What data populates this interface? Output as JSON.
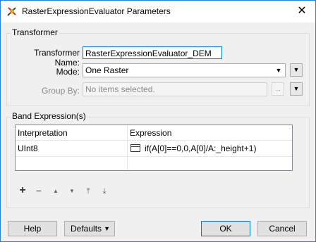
{
  "window": {
    "title": "RasterExpressionEvaluator Parameters",
    "close_glyph": "✕"
  },
  "transformer": {
    "group_label": "Transformer",
    "name_label": "Transformer Name:",
    "name_value": "RasterExpressionEvaluator_DEM",
    "mode_label": "Mode:",
    "mode_value": "One Raster",
    "group_by_label": "Group By:",
    "group_by_placeholder": "No items selected.",
    "browse_label": "..."
  },
  "band_expressions": {
    "group_label": "Band Expression(s)",
    "columns": [
      "Interpretation",
      "Expression"
    ],
    "rows": [
      {
        "interpretation": "UInt8",
        "expression": "if(A[0]==0,0,A[0]/A:_height+1)"
      }
    ],
    "toolbar": {
      "add": "+",
      "remove": "−",
      "move_up": "▲",
      "move_down": "▼",
      "move_top": "⤒",
      "move_bottom": "⤓"
    }
  },
  "footer": {
    "help": "Help",
    "defaults": "Defaults",
    "ok": "OK",
    "cancel": "Cancel"
  },
  "icons": {
    "app": "raster-transformer-icon",
    "dropdown": "▼"
  }
}
